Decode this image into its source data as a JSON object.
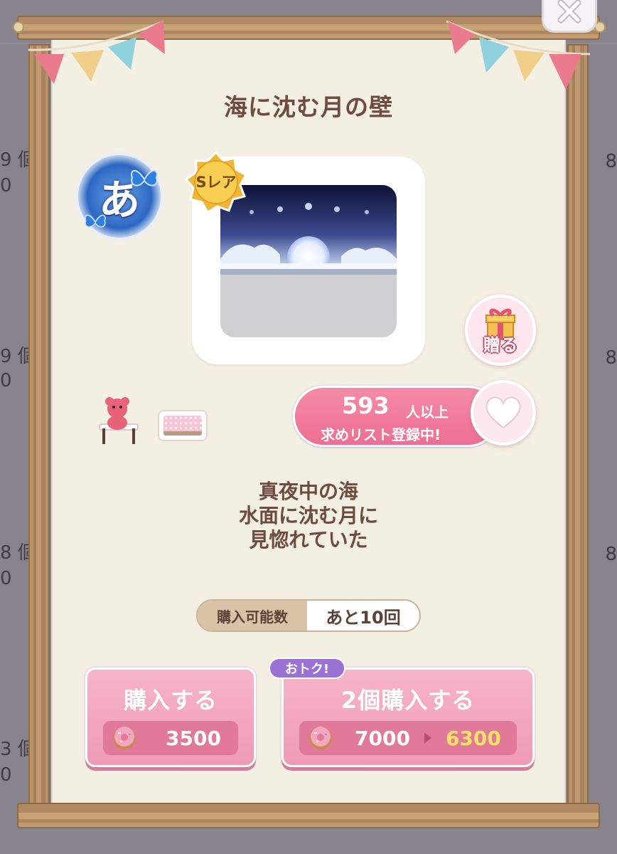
{
  "background": {
    "left_counts": [
      "9 個",
      "0",
      "9 個",
      "0",
      "8 個",
      "0",
      "3 個",
      "0"
    ],
    "right_counts": [
      "8",
      "8",
      "8"
    ]
  },
  "item": {
    "title": "海に沈む月の壁",
    "rarity": "Sレア",
    "description_lines": [
      "真夜中の海",
      "水面に沈む月に",
      "見惚れていた"
    ]
  },
  "badge": {
    "char": "あ"
  },
  "gift": {
    "label": "贈る"
  },
  "wishlist": {
    "count": "593",
    "suffix": "人以上",
    "line2": "求めリスト登録中!"
  },
  "purchase_limit": {
    "label": "購入可能数",
    "value": "あと10回"
  },
  "buy_single": {
    "label": "購入する",
    "price": "3500"
  },
  "buy_double": {
    "label": "2個購入する",
    "price_old": "7000",
    "price_new": "6300",
    "tag": "おトク!"
  },
  "colors": {
    "title": "#6e4b40",
    "button_pink": "#f7b4c8",
    "price_highlight": "#ffe16a",
    "deal_purple": "#9a72d6"
  }
}
